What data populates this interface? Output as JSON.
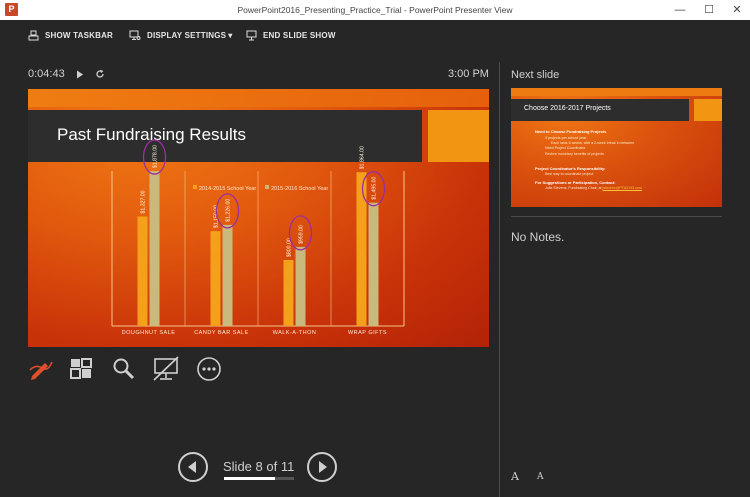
{
  "window": {
    "title": "PowerPoint2016_Presenting_Practice_Trial - PowerPoint Presenter View",
    "app_icon_letter": "P",
    "controls": {
      "minimize": "—",
      "maximize": "☐",
      "close": "✕"
    }
  },
  "toolbar": {
    "show_taskbar": "SHOW TASKBAR",
    "display_settings": "DISPLAY SETTINGS",
    "display_settings_caret": "▾",
    "end_slide_show": "END SLIDE SHOW"
  },
  "presenter": {
    "elapsed": "0:04:43",
    "clock": "3:00 PM",
    "slide_counter": "Slide 8 of 11",
    "slide_number": 8,
    "slide_total": 11
  },
  "current_slide": {
    "title": "Past Fundraising Results"
  },
  "chart_data": {
    "type": "bar",
    "title": "",
    "xlabel": "",
    "ylabel": "",
    "categories": [
      "DOUGHNUT SALE",
      "CANDY BAR SALE",
      "WALK-A-THON",
      "WRAP GIFTS"
    ],
    "series": [
      {
        "name": "2014-2015 School Year",
        "values": [
          1327,
          1150,
          800,
          1864
        ],
        "labels": [
          "$1,327.00",
          "$1,150.00",
          "$800.00",
          "$1,864.00"
        ],
        "color": "#f5a01a"
      },
      {
        "name": "2015-2016 School Year",
        "values": [
          1878,
          1226,
          959,
          1495
        ],
        "labels": [
          "$1,878.00",
          "$1,226.00",
          "$959.00",
          "$1,495.00"
        ],
        "color": "#c9b97c"
      }
    ],
    "ylim": [
      0,
      2000
    ],
    "grid": false,
    "legend": "top",
    "annotations": "ink circles drawn around the 2015-2016 value labels",
    "ink_color": "#9b2fa0"
  },
  "slide_tools": {
    "pen": "pen-tool-icon",
    "see_all": "see-all-slides-icon",
    "zoom": "zoom-icon",
    "black_screen": "black-screen-icon",
    "more": "more-options-icon",
    "accent_color": "#e0502a"
  },
  "next_slide": {
    "label": "Next slide",
    "title": "Choose 2016-2017 Projects",
    "lines": [
      "Need to Choose Fundraising Projects",
      "3 projects per school year",
      "Each lasts 6 weeks, with a 2-week break in between",
      "Need Project Coordinator",
      "Review monetary benefits of projects",
      "Project Coordinator's Responsibility:",
      "Best way to coordinate project",
      "For Suggestions or Participation, Contact:",
      "Julia Stevens, Fundraising Chair, at",
      "jstevens@PTA2193.com"
    ]
  },
  "notes": {
    "text": "No Notes.",
    "increase_font": "A",
    "decrease_font": "A"
  }
}
